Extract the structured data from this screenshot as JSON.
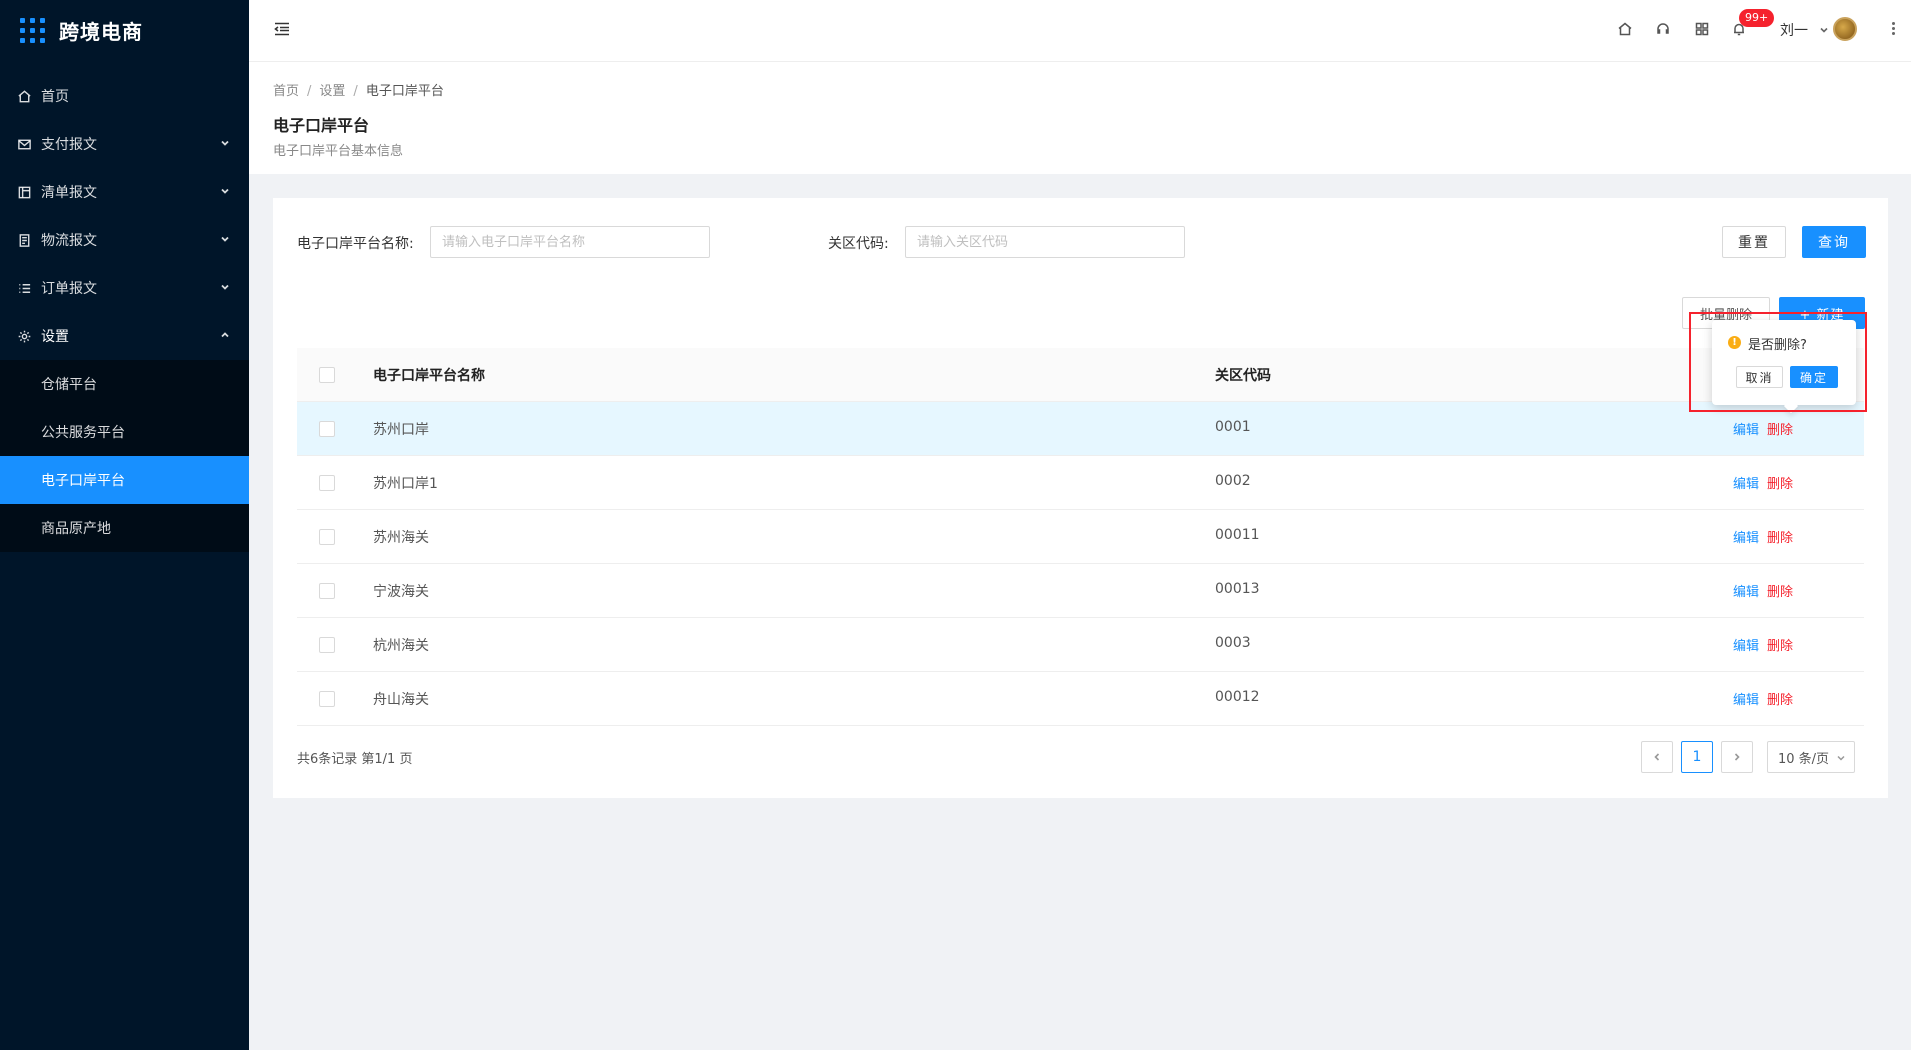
{
  "app": {
    "title": "跨境电商"
  },
  "sidebar": {
    "items": [
      {
        "label": "首页",
        "icon": "home-icon"
      },
      {
        "label": "支付报文",
        "icon": "mail-icon"
      },
      {
        "label": "清单报文",
        "icon": "list-box-icon"
      },
      {
        "label": "物流报文",
        "icon": "doc-icon"
      },
      {
        "label": "订单报文",
        "icon": "order-list-icon"
      },
      {
        "label": "设置",
        "icon": "gear-icon"
      }
    ],
    "sub_items": [
      {
        "label": "仓储平台"
      },
      {
        "label": "公共服务平台"
      },
      {
        "label": "电子口岸平台",
        "active": true
      },
      {
        "label": "商品原产地"
      }
    ]
  },
  "header": {
    "badge": "99+",
    "user_name": "刘一"
  },
  "page": {
    "breadcrumb": [
      "首页",
      "设置",
      "电子口岸平台"
    ],
    "title": "电子口岸平台",
    "description": "电子口岸平台基本信息"
  },
  "filters": {
    "name_label": "电子口岸平台名称:",
    "name_placeholder": "请输入电子口岸平台名称",
    "code_label": "关区代码:",
    "code_placeholder": "请输入关区代码",
    "reset": "重置",
    "search": "查询"
  },
  "toolbar": {
    "batch_delete": "批量删除",
    "create": "+ 新建"
  },
  "table": {
    "columns": [
      "电子口岸平台名称",
      "关区代码"
    ],
    "edit_label": "编辑",
    "delete_label": "删除",
    "rows": [
      {
        "name": "苏州口岸",
        "code": "0001"
      },
      {
        "name": "苏州口岸1",
        "code": "0002"
      },
      {
        "name": "苏州海关",
        "code": "00011"
      },
      {
        "name": "宁波海关",
        "code": "00013"
      },
      {
        "name": "杭州海关",
        "code": "0003"
      },
      {
        "name": "舟山海关",
        "code": "00012"
      }
    ]
  },
  "pagination": {
    "total_text": "共6条记录 第1/1 页",
    "current_page": "1",
    "page_size": "10 条/页"
  },
  "popconfirm": {
    "message": "是否删除?",
    "cancel": "取消",
    "ok": "确定"
  },
  "colors": {
    "sidebar_bg": "#001529",
    "primary": "#1890ff",
    "danger": "#f5222d",
    "highlight_box": "#f5222d"
  }
}
